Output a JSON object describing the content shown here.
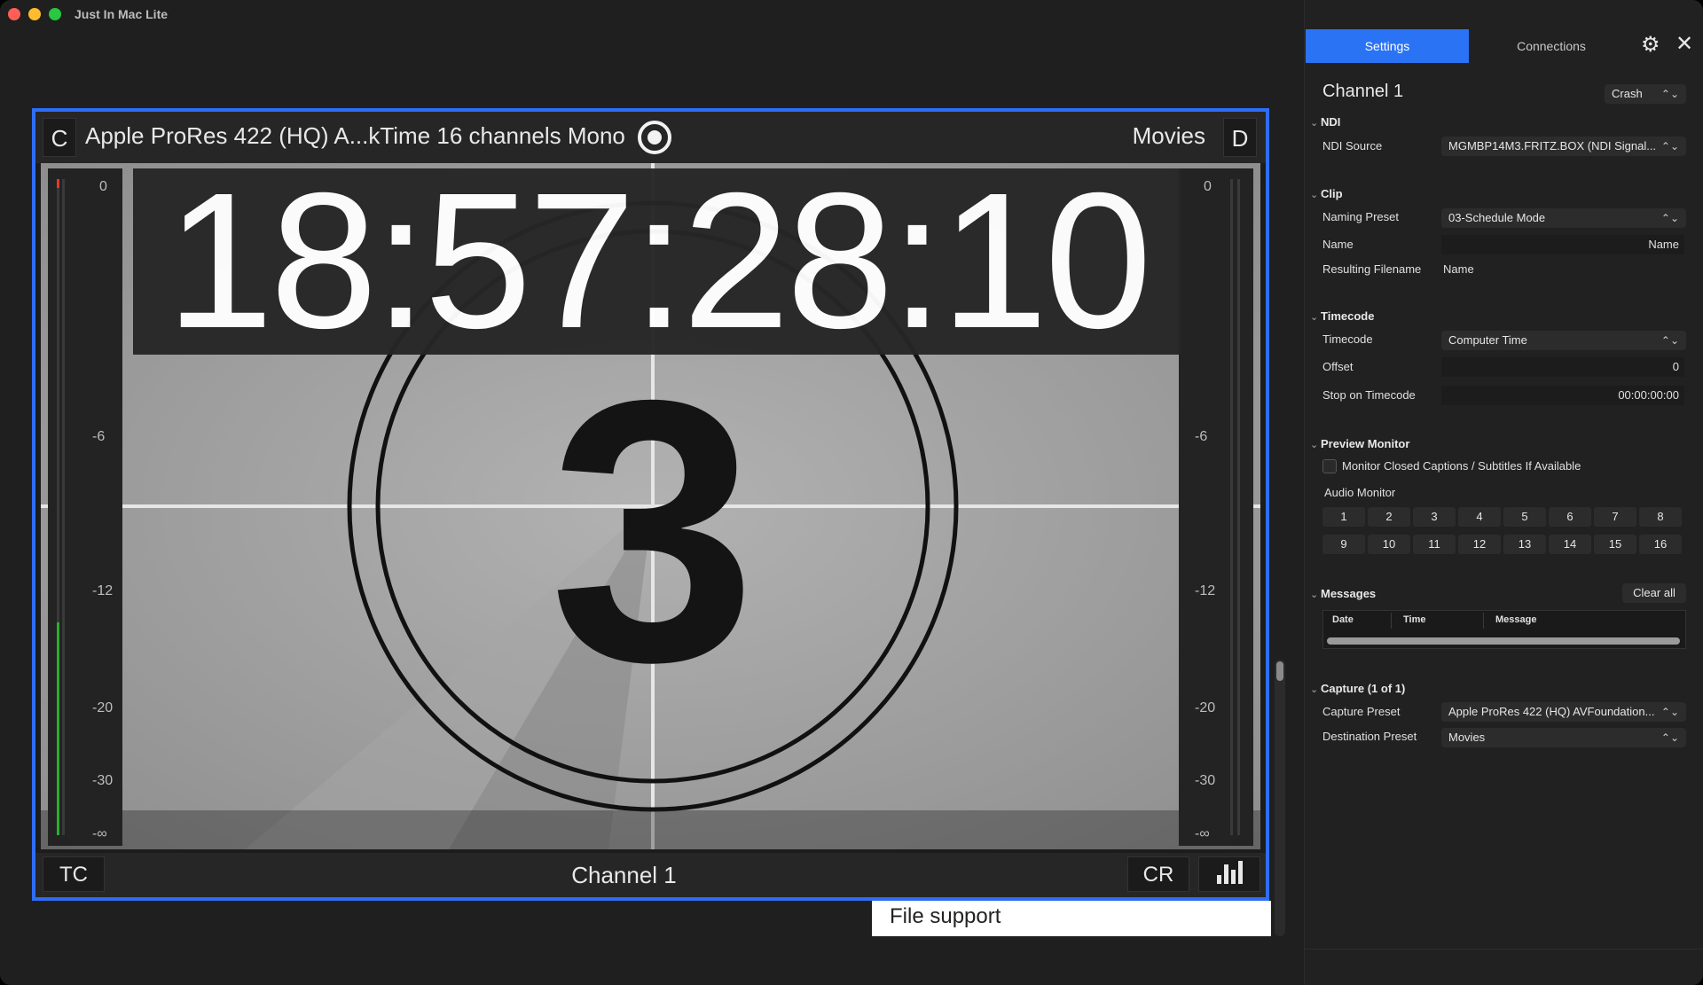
{
  "window": {
    "title": "Just In Mac Lite"
  },
  "channel_view": {
    "top_left_label": "C",
    "capture_preset_text": "Apple ProRes 422 (HQ) A...kTime 16 channels Mono",
    "destination_text": "Movies",
    "top_right_label": "D",
    "timecode": "18:57:28:10",
    "countdown_number": "3",
    "meter_ticks": [
      "0",
      "-6",
      "-12",
      "-20",
      "-30",
      "-∞"
    ],
    "bottom_left_label": "TC",
    "channel_name": "Channel 1",
    "bottom_right_label": "CR"
  },
  "file_support": "File support",
  "settings_panel": {
    "tabs": {
      "settings": "Settings",
      "connections": "Connections"
    },
    "channel_title": "Channel 1",
    "channel_mode": "Crash",
    "ndi": {
      "section": "NDI",
      "source_label": "NDI Source",
      "source_value": "MGMBP14M3.FRITZ.BOX (NDI Signal..."
    },
    "clip": {
      "section": "Clip",
      "naming_preset_label": "Naming Preset",
      "naming_preset_value": "03-Schedule Mode",
      "name_label": "Name",
      "name_value": "Name",
      "resulting_label": "Resulting Filename",
      "resulting_value": "Name"
    },
    "timecode": {
      "section": "Timecode",
      "timecode_label": "Timecode",
      "timecode_value": "Computer Time",
      "offset_label": "Offset",
      "offset_value": "0",
      "stop_label": "Stop on Timecode",
      "stop_value": "00:00:00:00"
    },
    "preview_monitor": {
      "section": "Preview Monitor",
      "checkbox_label": "Monitor Closed Captions / Subtitles If Available",
      "audio_monitor_label": "Audio Monitor",
      "channels": [
        "1",
        "2",
        "3",
        "4",
        "5",
        "6",
        "7",
        "8",
        "9",
        "10",
        "11",
        "12",
        "13",
        "14",
        "15",
        "16"
      ]
    },
    "messages": {
      "section": "Messages",
      "clear_label": "Clear all",
      "columns": [
        "Date",
        "Time",
        "Message"
      ]
    },
    "capture": {
      "section": "Capture (1 of 1)",
      "capture_preset_label": "Capture Preset",
      "capture_preset_value": "Apple ProRes 422 (HQ) AVFoundation...",
      "destination_label": "Destination Preset",
      "destination_value": "Movies"
    }
  },
  "colors": {
    "accent": "#2f6df6",
    "tab_active": "#2a73f5",
    "meter_level": "#28b030",
    "meter_peak": "#e03b2b"
  }
}
